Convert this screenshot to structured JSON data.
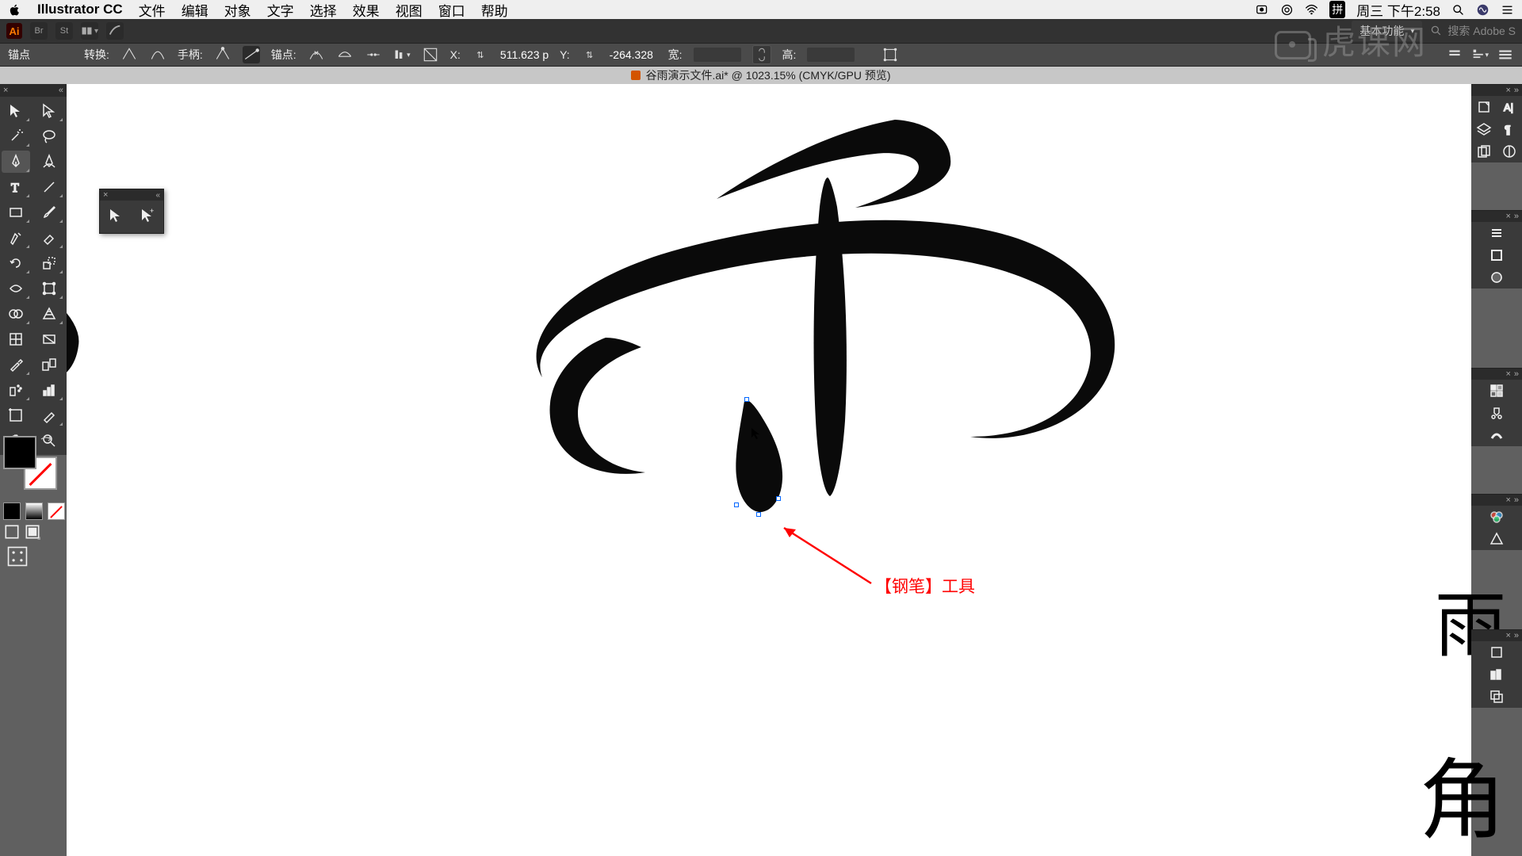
{
  "mac_menu": {
    "app": "Illustrator CC",
    "items": [
      "文件",
      "编辑",
      "对象",
      "文字",
      "选择",
      "效果",
      "视图",
      "窗口",
      "帮助"
    ],
    "ime": "拼",
    "date": "周三 下午2:58"
  },
  "appbar": {
    "workspace": "基本功能",
    "search_placeholder": "搜索 Adobe S"
  },
  "control": {
    "anchor_label": "锚点",
    "convert_label": "转换:",
    "handle_label": "手柄:",
    "anchor2_label": "锚点:",
    "x_label": "X:",
    "x_value": "511.623 p",
    "y_label": "Y:",
    "y_value": "-264.328",
    "w_label": "宽:",
    "h_label": "高:"
  },
  "doc": {
    "title": "谷雨演示文件.ai* @ 1023.15% (CMYK/GPU 预览)"
  },
  "annotation": {
    "text": "【钢笔】工具"
  },
  "watermark": "虎课网"
}
